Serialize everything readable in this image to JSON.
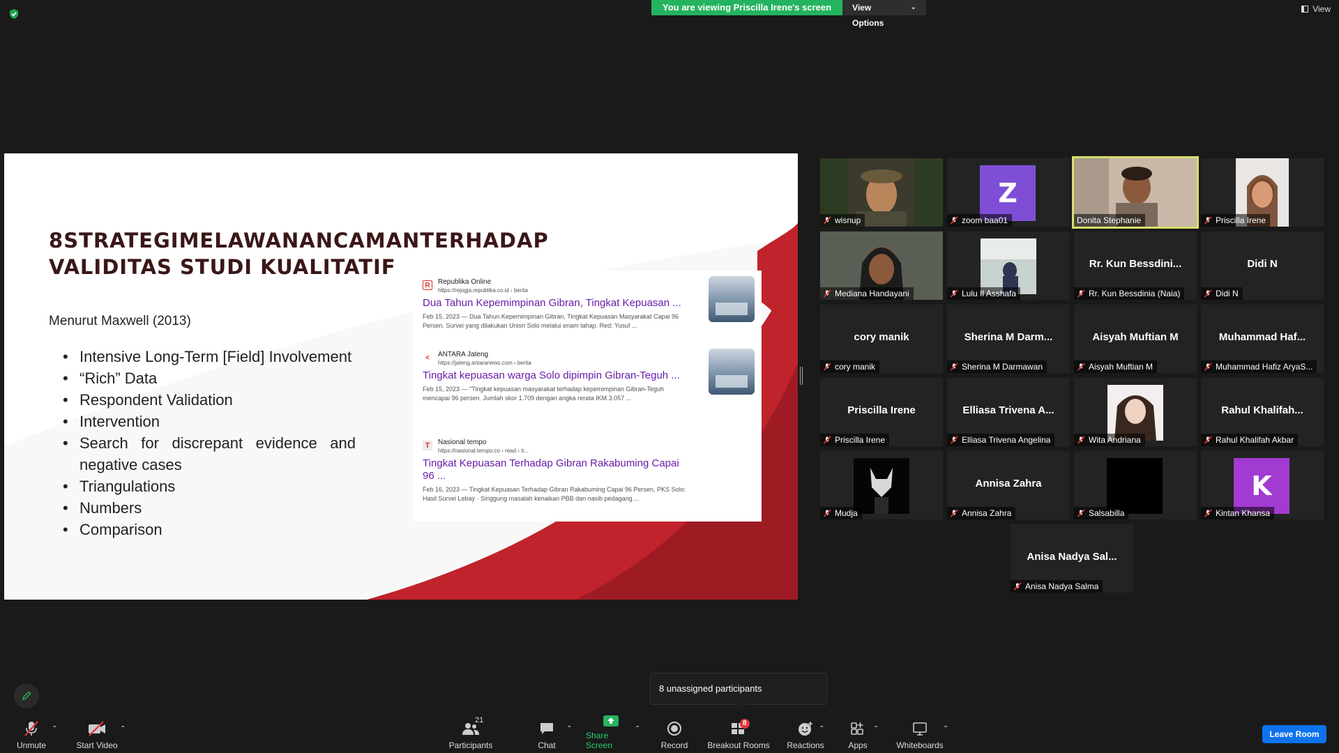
{
  "top_bar": {
    "share_banner": "You are viewing Priscilla Irene's screen",
    "view_options_label": "View Options",
    "view_label": "View"
  },
  "slide": {
    "title_line1_words": [
      "8",
      "STRATEGI",
      "MELAWAN",
      "ANCAMAN",
      "TERHADAP"
    ],
    "title_line2": "VALIDITAS STUDI KUALITATIF",
    "subtitle": "Menurut Maxwell (2013)",
    "bullets": [
      "Intensive Long-Term [Field] Involvement",
      "“Rich” Data",
      "Respondent Validation",
      "Intervention",
      "Search for discrepant evidence and negative cases",
      "Triangulations",
      "Numbers",
      "Comparison"
    ],
    "search_results": [
      {
        "source": "Republika Online",
        "url": "https://rejogja.republika.co.id › berita",
        "title": "Dua Tahun Kepemimpinan Gibran, Tingkat Kepuasan ...",
        "snippet": "Feb 15, 2023 — Dua Tahun Kepemimpinan Gibran, Tingkat Kepuasan Masyarakat Capai 96 Persen. Survei yang dilakukan Unisri Solo melalui enam tahap. Red: Yusuf ...",
        "favicon": "R"
      },
      {
        "source": "ANTARA Jateng",
        "url": "https://jateng.antaranews.com › berita",
        "title": "Tingkat kepuasan warga Solo dipimpin Gibran-Teguh ...",
        "snippet": "Feb 15, 2023 — \"Tingkat kepuasan masyarakat terhadap kepemimpinan Gibran-Teguh mencapai 96 persen. Jumlah skor 1.709 dengan angka rerata IKM 3.057 ...",
        "favicon": "<"
      },
      {
        "source": "Nasional tempo",
        "url": "https://nasional.tempo.co › read › ti...",
        "title": "Tingkat Kepuasan Terhadap Gibran Rakabuming Capai 96 ...",
        "snippet": "Feb 16, 2023 — Tingkat Kepuasan Terhadap Gibran Rakabuming Capai 96 Persen, PKS Solo: Hasil Survei Lebay · Singgung masalah kenaikan PBB dan nasib pedagang ...",
        "favicon": "T"
      }
    ]
  },
  "gallery": {
    "tiles": [
      {
        "big_name": "",
        "name": "wisnup"
      },
      {
        "big_name": "",
        "name": "zoom baa01",
        "avatar": "Z"
      },
      {
        "big_name": "",
        "name": "Donita Stephanie"
      },
      {
        "big_name": "",
        "name": "Priscilla Irene"
      },
      {
        "big_name": "",
        "name": "Mediana Handayani"
      },
      {
        "big_name": "",
        "name": "Lulu Il Asshafa"
      },
      {
        "big_name": "Rr. Kun Bessdini...",
        "name": "Rr. Kun Bessdinia (Naia)"
      },
      {
        "big_name": "Didi N",
        "name": "Didi N"
      },
      {
        "big_name": "cory manik",
        "name": "cory manik"
      },
      {
        "big_name": "Sherina M Darm...",
        "name": "Sherina M Darmawan"
      },
      {
        "big_name": "Aisyah Muftian M",
        "name": "Aisyah Muftian M"
      },
      {
        "big_name": "Muhammad Haf...",
        "name": "Muhammad Hafiz AryaS..."
      },
      {
        "big_name": "Priscilla Irene",
        "name": "Priscilla Irene"
      },
      {
        "big_name": "Elliasa Trivena A...",
        "name": "Elliasa Trivena Angelina"
      },
      {
        "big_name": "",
        "name": "Wita Andriana"
      },
      {
        "big_name": "Rahul Khalifah...",
        "name": "Rahul Khalifah Akbar"
      },
      {
        "big_name": "",
        "name": "Mudja"
      },
      {
        "big_name": "Annisa Zahra",
        "name": "Annisa Zahra"
      },
      {
        "big_name": "",
        "name": "Salsabilla"
      },
      {
        "big_name": "",
        "name": "Kintan Khansa",
        "avatar": "K"
      },
      {
        "big_name": "Anisa Nadya Sal...",
        "name": "Anisa Nadya Salma"
      }
    ]
  },
  "toolbar": {
    "unmute": "Unmute",
    "start_video": "Start Video",
    "participants": "Participants",
    "participants_count": "21",
    "chat": "Chat",
    "share_screen": "Share Screen",
    "record": "Record",
    "breakout_rooms": "Breakout Rooms",
    "breakout_badge": "8",
    "reactions": "Reactions",
    "apps": "Apps",
    "whiteboards": "Whiteboards",
    "leave_room": "Leave Room",
    "unassigned_tooltip": "8 unassigned participants"
  },
  "colors": {
    "share_green": "#24b35f",
    "leave_blue": "#0e72ed",
    "speaker_border": "#d8df6a",
    "slide_red": "#c0232c",
    "link_purple": "#681da8",
    "avatar_purple_z": "#7e4fd6",
    "avatar_purple_k": "#a23bd1"
  }
}
